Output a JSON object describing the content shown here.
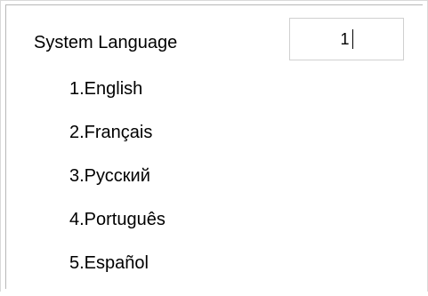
{
  "language_setting": {
    "label": "System Language",
    "value": "1",
    "options": [
      "1.English",
      "2.Français",
      "3.Русский",
      "4.Português",
      "5.Español"
    ]
  }
}
